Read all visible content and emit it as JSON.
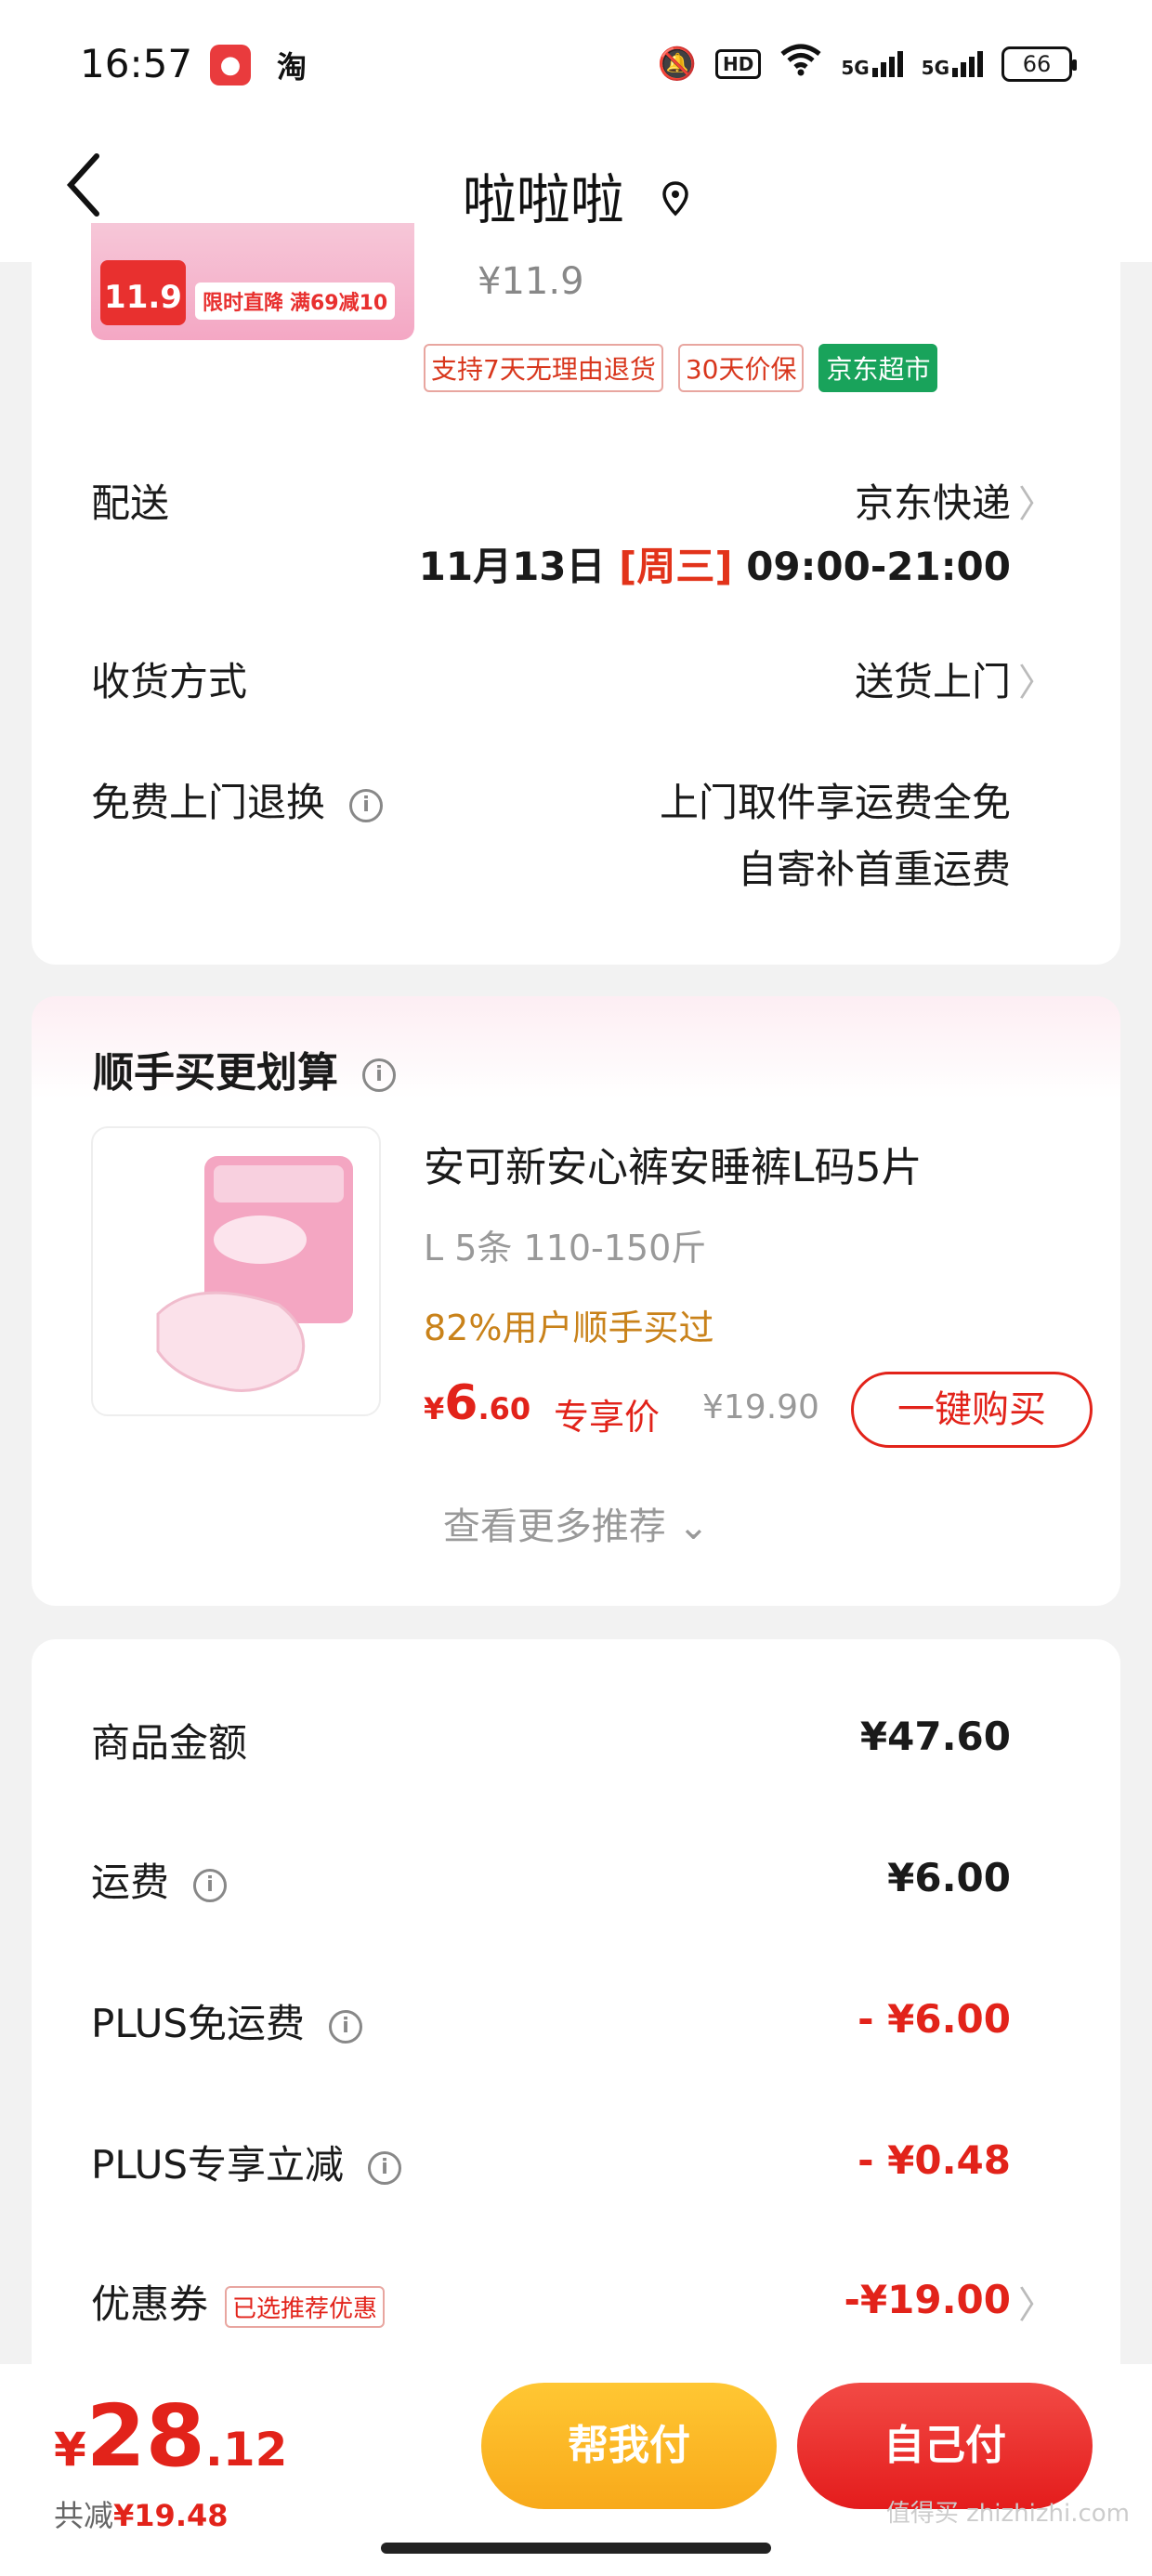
{
  "status_bar": {
    "time": "16:57",
    "app_icons": [
      "jd-app-icon",
      "taobao-app-icon"
    ],
    "taobao_glyph": "淘",
    "hd": "HD",
    "net1": "5G",
    "net2": "5G",
    "battery": "66"
  },
  "header": {
    "title": "啦啦啦",
    "back_icon": "chevron-left-icon",
    "location_icon": "location-pin-icon"
  },
  "product_top": {
    "badge_price": "11.9",
    "promo1": "限时直降",
    "promo2": "满69减10",
    "price": "¥11.9",
    "service_tags": [
      "支持7天无理由退货",
      "30天价保",
      "京东超市"
    ]
  },
  "delivery": {
    "label": "配送",
    "carrier": "京东快递",
    "date": "11月13日",
    "weekday": "[周三]",
    "time_window": "09:00-21:00"
  },
  "receive": {
    "label": "收货方式",
    "value": "送货上门"
  },
  "free_return": {
    "label": "免费上门退换",
    "line1": "上门取件享运费全免",
    "line2": "自寄补首重运费"
  },
  "addon": {
    "title": "顺手买更划算",
    "product_name": "安可新安心裤安睡裤L码5片",
    "spec": "L 5条 110-150斤",
    "rate": "82%用户顺手买过",
    "price_symbol": "¥",
    "price_int": "6",
    "price_dec": ".60",
    "price_label": "专享价",
    "orig_price": "¥19.90",
    "buy_button": "一键购买",
    "more": "查看更多推荐"
  },
  "summary": {
    "items": [
      {
        "label": "商品金额",
        "value": "¥47.60",
        "info": false,
        "red": false
      },
      {
        "label": "运费",
        "value": "¥6.00",
        "info": true,
        "red": false
      },
      {
        "label": "PLUS免运费",
        "value": "- ¥6.00",
        "info": true,
        "red": true
      },
      {
        "label": "PLUS专享立减",
        "value": "- ¥0.48",
        "info": true,
        "red": true
      }
    ],
    "coupon_label": "优惠券",
    "coupon_tag": "已选推荐优惠",
    "coupon_value": "-¥19.00"
  },
  "bottom": {
    "currency": "¥",
    "total_int": "28",
    "total_dec": ".12",
    "saved_label": "共减",
    "saved_value": "¥19.48",
    "help_pay": "帮我付",
    "self_pay": "自己付"
  },
  "watermark": "值得买 zhizhizhi.com",
  "colors": {
    "accent_red": "#e2231a",
    "yellow": "#f8a91a",
    "green": "#19a35b"
  }
}
